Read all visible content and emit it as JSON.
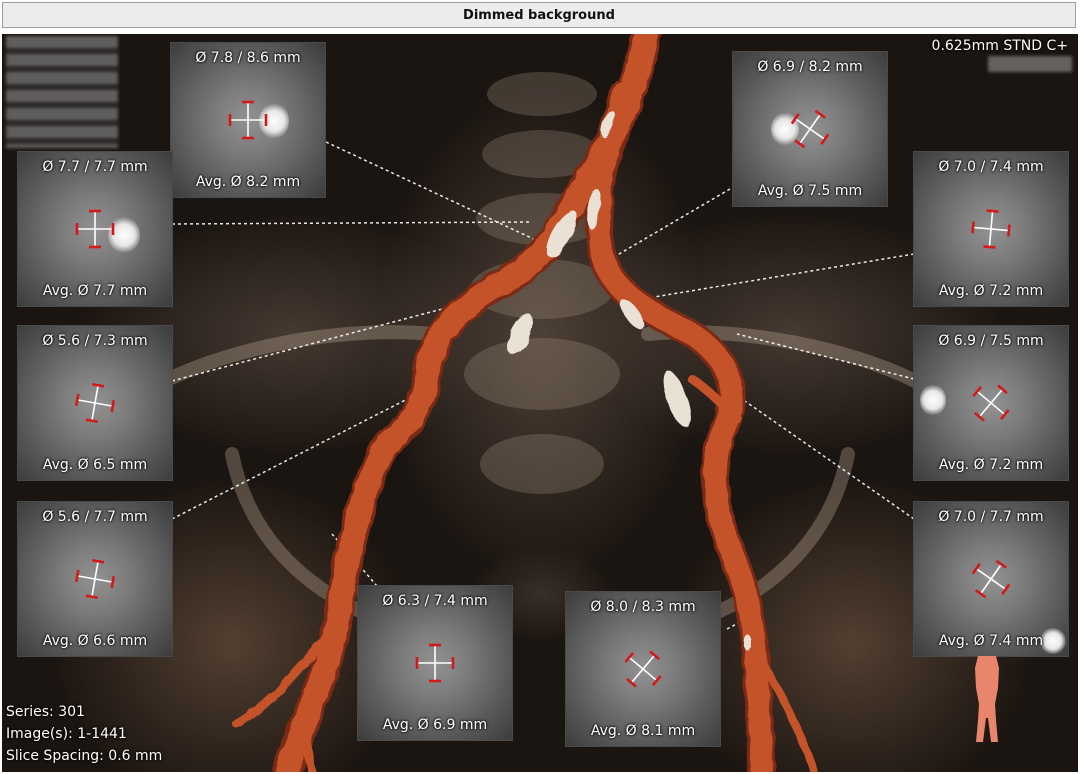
{
  "window": {
    "title": "Dimmed background"
  },
  "overlay": {
    "protocol": "0.625mm STND  C+",
    "series": "Series: 301",
    "images": "Image(s): 1-1441",
    "slice_spacing": "Slice Spacing: 0.6 mm"
  },
  "panels": [
    {
      "id": "right-common-iliac",
      "diameter": "Ø 7.8 / 8.6 mm",
      "average": "Avg. Ø 8.2 mm",
      "cross_angle_deg": 0
    },
    {
      "id": "right-common-iliac-distal",
      "diameter": "Ø 7.7 / 7.7 mm",
      "average": "Avg. Ø 7.7 mm",
      "cross_angle_deg": 0
    },
    {
      "id": "right-external-iliac-proximal",
      "diameter": "Ø 5.6 / 7.3 mm",
      "average": "Avg. Ø 6.5 mm",
      "cross_angle_deg": 10
    },
    {
      "id": "right-external-iliac-mid",
      "diameter": "Ø 5.6 / 7.7 mm",
      "average": "Avg. Ø 6.6 mm",
      "cross_angle_deg": 10
    },
    {
      "id": "right-external-iliac-distal",
      "diameter": "Ø 6.3 / 7.4 mm",
      "average": "Avg. Ø 6.9 mm",
      "cross_angle_deg": 0
    },
    {
      "id": "left-external-iliac-distal",
      "diameter": "Ø 8.0 / 8.3 mm",
      "average": "Avg. Ø 8.1 mm",
      "cross_angle_deg": 40
    },
    {
      "id": "left-common-iliac",
      "diameter": "Ø 6.9 / 8.2 mm",
      "average": "Avg. Ø 7.5 mm",
      "cross_angle_deg": 35
    },
    {
      "id": "left-common-iliac-distal",
      "diameter": "Ø 7.0 / 7.4 mm",
      "average": "Avg. Ø 7.2 mm",
      "cross_angle_deg": 5
    },
    {
      "id": "left-external-iliac-proximal",
      "diameter": "Ø 6.9 / 7.5 mm",
      "average": "Avg. Ø 7.2 mm",
      "cross_angle_deg": 40
    },
    {
      "id": "left-external-iliac-mid",
      "diameter": "Ø 7.0 / 7.7 mm",
      "average": "Avg. Ø 7.4 mm",
      "cross_angle_deg": 35
    }
  ],
  "colors": {
    "vessel": "#c4522a",
    "vessel_dark": "#7a2c12",
    "calcification": "#e9e2d4",
    "crosshair": "#ffffff",
    "marker": "#d21a1a",
    "leader": "#ffffff",
    "body_icon": "#e8856c"
  },
  "icons": {
    "orientation": "human-body-orientation-icon"
  }
}
